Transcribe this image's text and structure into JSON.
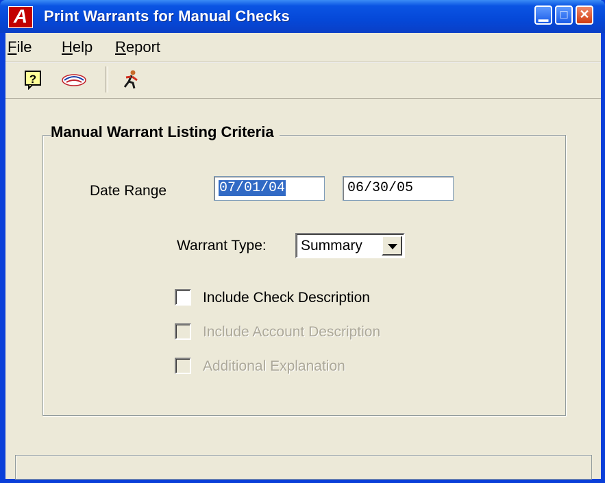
{
  "window": {
    "title": "Print Warrants for Manual Checks",
    "app_logo": "A",
    "controls": {
      "minimize": "▁",
      "maximize": "□",
      "close": "✕"
    }
  },
  "menu": [
    {
      "label": "File"
    },
    {
      "label": "Help"
    },
    {
      "label": "Report"
    }
  ],
  "toolbar": {
    "buttons": [
      {
        "icon": "help-question-icon"
      },
      {
        "icon": "client-logo-icon"
      },
      {
        "icon": "running-man-exit-icon"
      }
    ]
  },
  "criteria": {
    "group_title": "Manual Warrant Listing Criteria",
    "date_range_label": "Date Range",
    "date_from": "07/01/04",
    "date_to": "06/30/05",
    "warrant_type_label": "Warrant Type:",
    "warrant_type_value": "Summary",
    "options": [
      {
        "label": "Include Check Description",
        "checked": false,
        "enabled": true
      },
      {
        "label": "Include Account Description",
        "checked": false,
        "enabled": false
      },
      {
        "label": "Additional Explanation",
        "checked": false,
        "enabled": false
      }
    ]
  },
  "statusbar": {
    "text": ""
  },
  "colors": {
    "titlebar": "#0a54e3",
    "window_bg": "#ece9d8",
    "selection": "#316ac5",
    "disabled_text": "#aca899",
    "logo_red": "#c30000"
  }
}
